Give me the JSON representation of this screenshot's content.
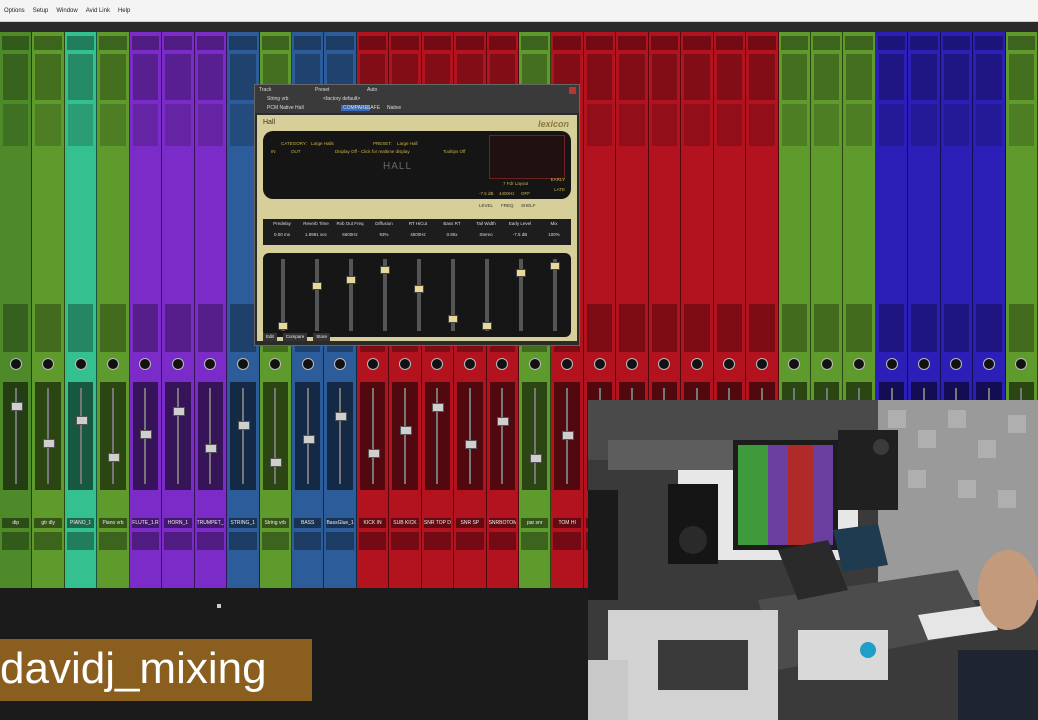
{
  "menu": [
    "Options",
    "Setup",
    "Window",
    "Avid Link",
    "Help"
  ],
  "colors": {
    "green": "#5f9a2c",
    "teal": "#2fbf84",
    "purple": "#7a2cc4",
    "blue": "#2c5c9a",
    "red": "#b3121f",
    "navy": "#2c1fb8",
    "accent_gold": "#c8b34a"
  },
  "channels": [
    {
      "name": "dip",
      "color": "#4e8a2a"
    },
    {
      "name": "gtr dly",
      "color": "#5f9a2c"
    },
    {
      "name": "PIANO_1",
      "color": "#35c08f"
    },
    {
      "name": "Piano vrb",
      "color": "#5f9a2c"
    },
    {
      "name": "FLUTE_1.R",
      "color": "#7b2cc8"
    },
    {
      "name": "HORN_1",
      "color": "#7b2cc8"
    },
    {
      "name": "TRUMPET_1",
      "color": "#7b2cc8"
    },
    {
      "name": "STRING_1",
      "color": "#2c5c9a"
    },
    {
      "name": "String vrb",
      "color": "#5f9a2c"
    },
    {
      "name": "BASS",
      "color": "#2c5c9a"
    },
    {
      "name": "BassGlue_1",
      "color": "#2c5c9a"
    },
    {
      "name": "KICK IN",
      "color": "#b3121f"
    },
    {
      "name": "SUB KICK",
      "color": "#b3121f"
    },
    {
      "name": "SNR TOP D",
      "color": "#b3121f"
    },
    {
      "name": "SNR SP",
      "color": "#b3121f"
    },
    {
      "name": "SNRBOTOM",
      "color": "#b3121f"
    },
    {
      "name": "par snr",
      "color": "#5f9a2c"
    },
    {
      "name": "TOM HI",
      "color": "#b3121f"
    },
    {
      "name": "",
      "color": "#b3121f"
    },
    {
      "name": "",
      "color": "#b3121f"
    },
    {
      "name": "",
      "color": "#b3121f"
    },
    {
      "name": "",
      "color": "#b3121f"
    },
    {
      "name": "",
      "color": "#b3121f"
    },
    {
      "name": "",
      "color": "#b3121f"
    },
    {
      "name": "",
      "color": "#5f9a2c"
    },
    {
      "name": "",
      "color": "#5f9a2c"
    },
    {
      "name": "",
      "color": "#5f9a2c"
    },
    {
      "name": "",
      "color": "#2c1fb8"
    },
    {
      "name": "",
      "color": "#2c1fb8"
    },
    {
      "name": "",
      "color": "#2c1fb8"
    },
    {
      "name": "",
      "color": "#2c1fb8"
    },
    {
      "name": "",
      "color": "#5f9a2c"
    }
  ],
  "plugin": {
    "track_label": "Track",
    "preset_label": "Preset",
    "auto_label": "Auto",
    "track_value": "String vrb",
    "preset_value": "<factory default>",
    "plugin_name": "PCM Native Hall",
    "compare": "COMPARE",
    "safe": "SAFE",
    "native": "Native",
    "brand_small": "Hall",
    "brand": "lexicon",
    "category_label": "CATEGORY:",
    "category_value": "Large Halls",
    "preset_label2": "PRESET:",
    "preset_value2": "Large Hall",
    "display_msg": "Display Off - Click for realtime display",
    "tooltip": "Tooltips Off",
    "display_name": "HALL",
    "early": "EARLY",
    "late": "LATE",
    "level": "LEVEL",
    "freq": "FREQ",
    "shelf": "SHELF",
    "level_val": "-7.5 dB",
    "freq_val": "4400Hz",
    "shelf_val": "OFF",
    "in_lbl": "IN",
    "out_lbl": "OUT",
    "view": "7 Fdr Layout",
    "params": [
      {
        "label": "Predelay",
        "value": "0.00 ms"
      },
      {
        "label": "Reverb Time",
        "value": "1.9981 sec"
      },
      {
        "label": "Rvb Out Freq",
        "value": "6600Hz"
      },
      {
        "label": "Diffusion",
        "value": "93%"
      },
      {
        "label": "RT HiCut",
        "value": "4500Hz"
      },
      {
        "label": "Bass RT",
        "value": "0.90x"
      },
      {
        "label": "Tail Width",
        "value": "Stereo"
      },
      {
        "label": "Early Level",
        "value": "-7.5 dB"
      },
      {
        "label": "Mix",
        "value": "100%"
      }
    ],
    "faders": [
      0.05,
      0.65,
      0.75,
      0.9,
      0.6,
      0.15,
      0.05,
      0.85,
      0.95
    ],
    "buttons": [
      "Edit",
      "Compare",
      "Store"
    ]
  },
  "watermark": "davidj_mixing"
}
